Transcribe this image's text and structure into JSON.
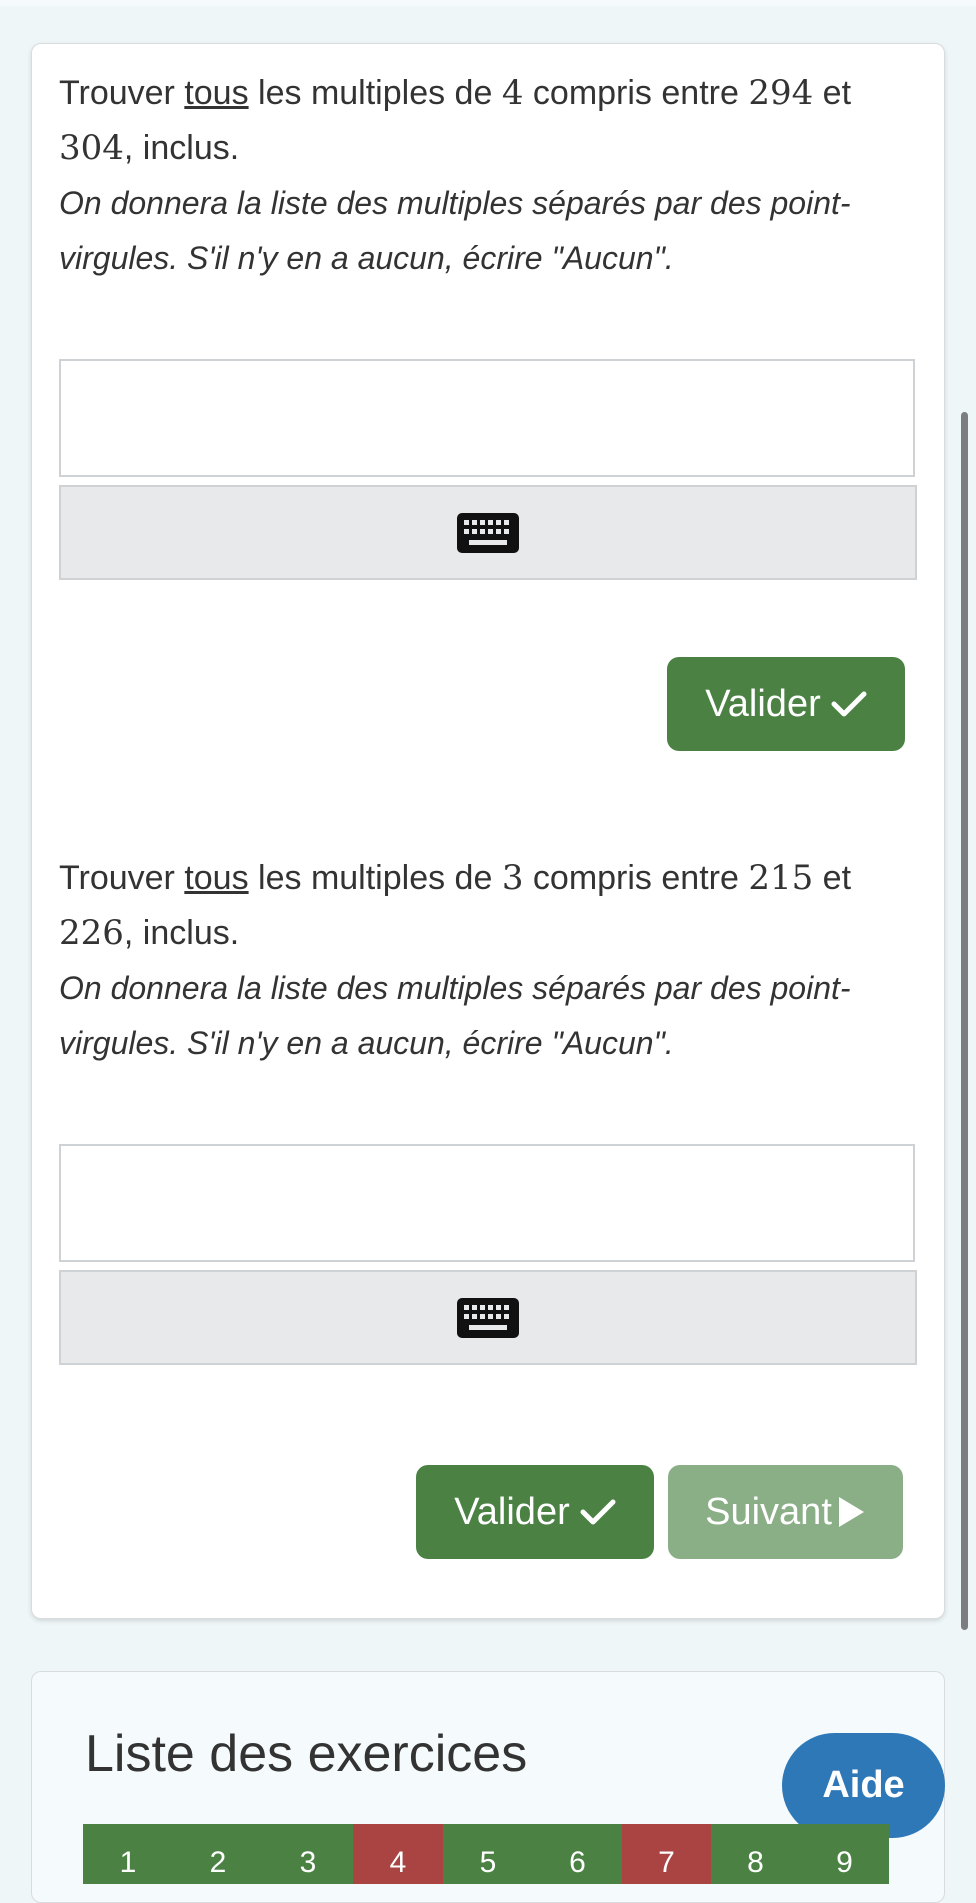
{
  "exercises": [
    {
      "q_pre": "Trouver ",
      "q_u": "tous",
      "q_mid": " les multiples de ",
      "n": "4",
      "q_mid2": " compris entre ",
      "a": "294",
      "q_et": " et ",
      "b": "304",
      "q_end": ", inclus.",
      "instruction": "On donnera la liste des multiples séparés par des point-virgules. S'il n'y en a aucun, écrire \"Aucun\".",
      "answer_value": "",
      "valider_label": "Valider"
    },
    {
      "q_pre": "Trouver ",
      "q_u": "tous",
      "q_mid": " les multiples de ",
      "n": "3",
      "q_mid2": " compris entre ",
      "a": "215",
      "q_et": " et ",
      "b": "226",
      "q_end": ", inclus.",
      "instruction": "On donnera la liste des multiples séparés par des point-virgules. S'il n'y en a aucun, écrire \"Aucun\".",
      "answer_value": "",
      "valider_label": "Valider",
      "suivant_label": "Suivant"
    }
  ],
  "list": {
    "title": "Liste des exercices",
    "aide_label": "Aide",
    "numbers": [
      "1",
      "2",
      "3",
      "4",
      "5",
      "6",
      "7",
      "8",
      "9"
    ],
    "status_colors": [
      "#4b8244",
      "#4b8244",
      "#4b8244",
      "#a94442",
      "#4b8244",
      "#4b8244",
      "#a94442",
      "#4b8244",
      "#4b8244"
    ]
  },
  "colors": {
    "valider": "#4b8244",
    "suivant": "#8aae86",
    "aide": "#2f78b8",
    "wrong": "#a94442"
  }
}
